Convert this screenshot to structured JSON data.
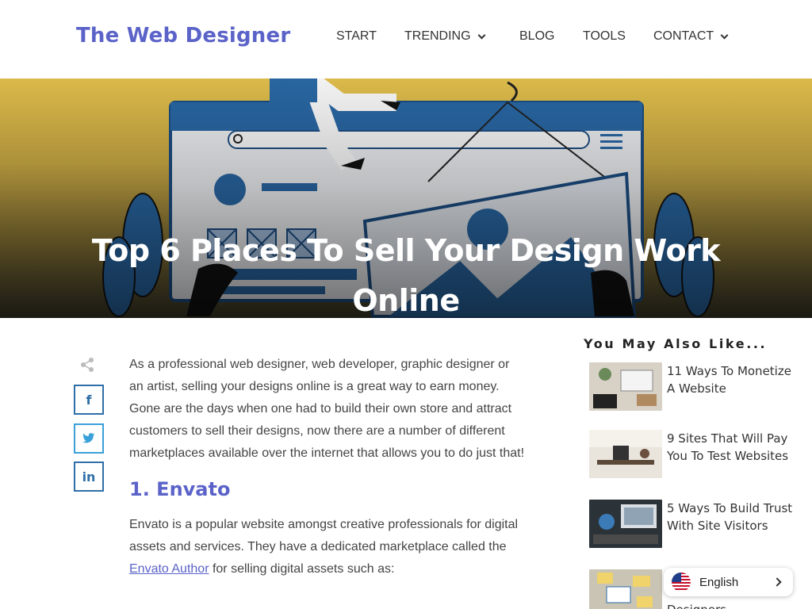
{
  "header": {
    "logo": "The Web Designer",
    "nav": [
      {
        "label": "START",
        "has_dropdown": false
      },
      {
        "label": "TRENDING",
        "has_dropdown": true
      },
      {
        "label": "BLOG",
        "has_dropdown": false
      },
      {
        "label": "TOOLS",
        "has_dropdown": false
      },
      {
        "label": "CONTACT",
        "has_dropdown": true
      }
    ]
  },
  "hero": {
    "title": "Top 6 Places To Sell Your Design Work Online"
  },
  "share": {
    "buttons": [
      {
        "network": "facebook",
        "glyph": "f"
      },
      {
        "network": "twitter",
        "glyph": "t"
      },
      {
        "network": "linkedin",
        "glyph": "in"
      }
    ]
  },
  "article": {
    "intro": "As a professional web designer, web developer, graphic designer or an artist, selling your designs online is a great way to earn money. Gone are the days when one had to build their own store and attract customers to sell their designs, now there are a number of different marketplaces available over the internet that allows you to do just that!",
    "section1_heading": "1. Envato",
    "section1_text_before": "Envato is a popular website amongst creative professionals for digital assets and services. They have a dedicated marketplace called the ",
    "section1_link": "Envato Author",
    "section1_text_after": " for selling digital assets such as:"
  },
  "sidebar": {
    "title": "You May Also Like...",
    "items": [
      {
        "title": "11 Ways To Monetize A Website"
      },
      {
        "title": "9 Sites That Will Pay You To Test Websites"
      },
      {
        "title": "5 Ways To Build Trust With Site Visitors"
      },
      {
        "title": "Designers"
      }
    ]
  },
  "language": {
    "label": "English",
    "flag": "us-flag-icon"
  },
  "colors": {
    "brand": "#5b63c9",
    "share_border": "#2f6fa8",
    "hero_yellow": "#e7c44e"
  }
}
